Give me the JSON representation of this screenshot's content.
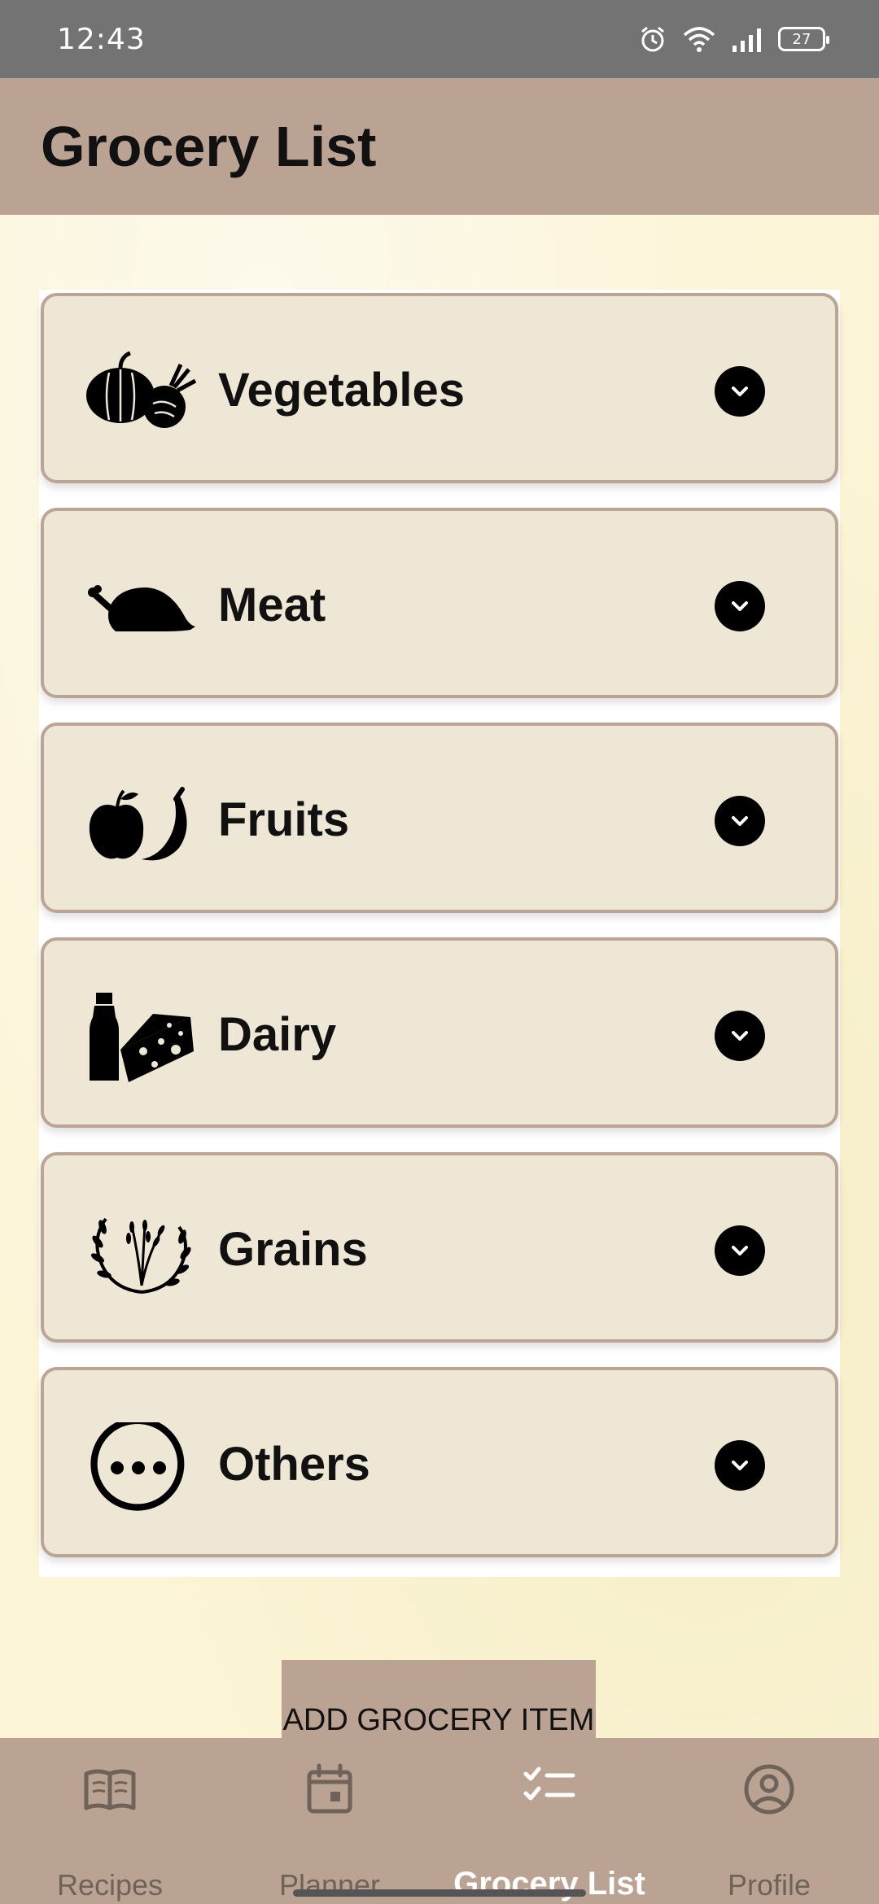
{
  "status_bar": {
    "time": "12:43",
    "battery": "27",
    "icons": [
      "alarm-icon",
      "wifi-icon",
      "signal-icon",
      "battery-icon"
    ]
  },
  "app_bar": {
    "title": "Grocery List"
  },
  "categories": [
    {
      "label": "Vegetables",
      "icon": "vegetables-icon"
    },
    {
      "label": "Meat",
      "icon": "meat-icon"
    },
    {
      "label": "Fruits",
      "icon": "fruits-icon"
    },
    {
      "label": "Dairy",
      "icon": "dairy-icon"
    },
    {
      "label": "Grains",
      "icon": "grains-icon"
    },
    {
      "label": "Others",
      "icon": "others-icon"
    }
  ],
  "add_button": {
    "label": "ADD GROCERY ITEM"
  },
  "bottom_nav": {
    "items": [
      {
        "label": "Recipes",
        "icon": "book-icon",
        "active": false
      },
      {
        "label": "Planner",
        "icon": "calendar-icon",
        "active": false
      },
      {
        "label": "Grocery List",
        "icon": "checklist-icon",
        "active": true
      },
      {
        "label": "Profile",
        "icon": "account-circle-icon",
        "active": false
      }
    ]
  },
  "colors": {
    "status_bar": "#737373",
    "app_bar": "#bba393",
    "card_bg": "#efe7d6",
    "card_border": "#bca594",
    "page_bg": "#fbf4d6",
    "nav_active": "#ffffff",
    "nav_inactive": "#6f6258"
  }
}
